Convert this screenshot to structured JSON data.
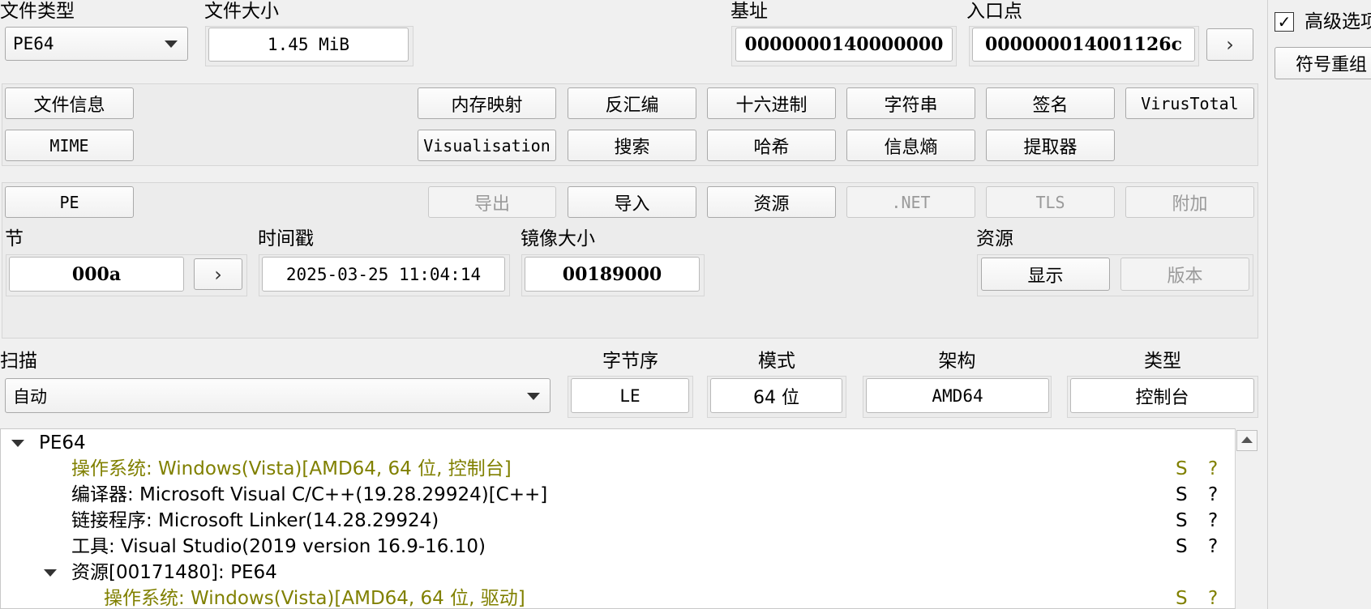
{
  "header": {
    "file_type_label": "文件类型",
    "file_type_value": "PE64",
    "file_size_label": "文件大小",
    "file_size_value": "1.45 MiB",
    "base_address_label": "基址",
    "base_address_value": "0000000140000000",
    "entry_point_label": "入口点",
    "entry_point_value": "000000014001126c",
    "advanced_label": "高级选项",
    "symbol_button": "符号重组"
  },
  "tools_row1": [
    "文件信息",
    "内存映射",
    "反汇编",
    "十六进制",
    "字符串",
    "签名",
    "VirusTotal"
  ],
  "tools_row2": [
    "MIME",
    "Visualisation",
    "搜索",
    "哈希",
    "信息熵",
    "提取器"
  ],
  "pe_row": [
    "PE",
    "导出",
    "导入",
    "资源",
    ".NET",
    "TLS",
    "附加"
  ],
  "pe_info": {
    "section_label": "节",
    "section_value": "000a",
    "timestamp_label": "时间戳",
    "timestamp_value": "2025-03-25 11:04:14",
    "image_size_label": "镜像大小",
    "image_size_value": "00189000",
    "resources_label": "资源",
    "show_button": "显示",
    "version_button": "版本"
  },
  "scan": {
    "scan_label": "扫描",
    "scan_value": "自动",
    "endian_label": "字节序",
    "endian_value": "LE",
    "mode_label": "模式",
    "mode_value": "64 位",
    "arch_label": "架构",
    "arch_value": "AMD64",
    "type_label": "类型",
    "type_value": "控制台"
  },
  "tree": {
    "root": "PE64",
    "items": [
      {
        "text": "操作系统: Windows(Vista)[AMD64, 64 位, 控制台]",
        "s": "S",
        "q": "?"
      },
      {
        "text": "编译器: Microsoft Visual C/C++(19.28.29924)[C++]",
        "s": "S",
        "q": "?"
      },
      {
        "text": "链接程序: Microsoft Linker(14.28.29924)",
        "s": "S",
        "q": "?"
      },
      {
        "text": "工具: Visual Studio(2019 version 16.9-16.10)",
        "s": "S",
        "q": "?"
      }
    ],
    "resource_node": "资源[00171480]: PE64",
    "resource_items": [
      {
        "text": "操作系统: Windows(Vista)[AMD64, 64 位, 驱动]",
        "s": "S",
        "q": "?"
      }
    ]
  },
  "colors": {
    "highlight_text": "#808000"
  }
}
